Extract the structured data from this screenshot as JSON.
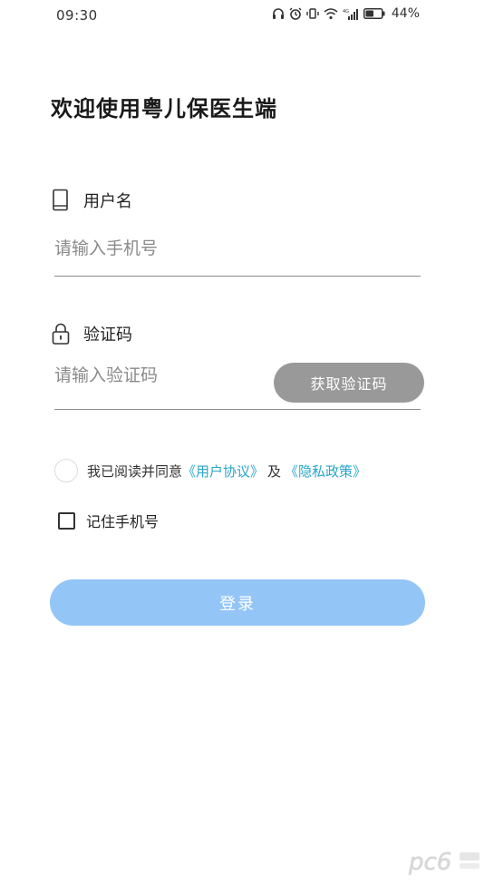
{
  "status_bar": {
    "time": "09:30",
    "battery": "44%",
    "icons": [
      "headset-icon",
      "alarm-icon",
      "vibrate-icon",
      "wifi-icon",
      "signal-icon",
      "battery-icon"
    ],
    "network_tag": "4G"
  },
  "header": {
    "title": "欢迎使用粤儿保医生端"
  },
  "username": {
    "label": "用户名",
    "icon": "phone-icon",
    "placeholder": "请输入手机号",
    "value": ""
  },
  "code": {
    "label": "验证码",
    "icon": "lock-icon",
    "placeholder": "请输入验证码",
    "value": "",
    "button_label": "获取验证码"
  },
  "agreement": {
    "prefix": "我已阅读并同意",
    "user_agreement": "《用户协议》",
    "separator": "及",
    "privacy_policy": "《隐私政策》"
  },
  "remember": {
    "label": "记住手机号"
  },
  "login": {
    "label": "登录"
  },
  "watermark": {
    "logo": "pc6-logo",
    "text": "pc6"
  },
  "colors": {
    "link": "#2aa5c9",
    "login_button": "#93c5f7",
    "code_button": "#999999"
  }
}
